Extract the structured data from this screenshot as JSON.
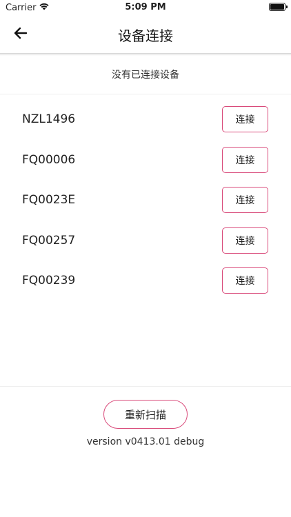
{
  "status_bar": {
    "carrier": "Carrier",
    "time": "5:09 PM",
    "battery_level": 1.0
  },
  "nav": {
    "title": "设备连接",
    "back_icon": "arrow-left-icon"
  },
  "connection_status": "没有已连接设备",
  "devices": [
    {
      "name": "NZL1496",
      "action": "连接"
    },
    {
      "name": "FQ00006",
      "action": "连接"
    },
    {
      "name": "FQ0023E",
      "action": "连接"
    },
    {
      "name": "FQ00257",
      "action": "连接"
    },
    {
      "name": "FQ00239",
      "action": "连接"
    }
  ],
  "rescan_label": "重新扫描",
  "version": "version v0413.01 debug",
  "colors": {
    "accent": "#d94a7a",
    "divider": "#d8d8d8"
  }
}
